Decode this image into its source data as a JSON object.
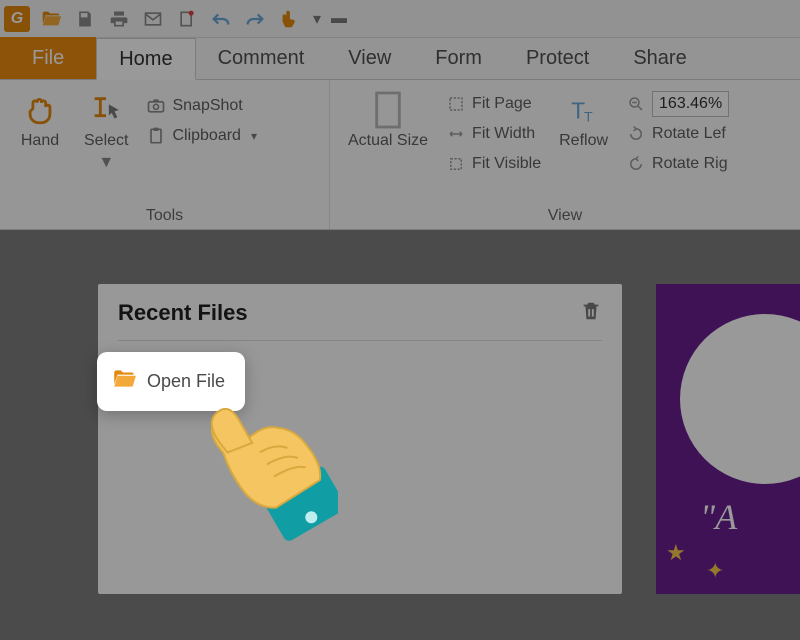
{
  "qat": {
    "logo_char": "G"
  },
  "tabs": {
    "file": "File",
    "items": [
      "Home",
      "Comment",
      "View",
      "Form",
      "Protect",
      "Share"
    ],
    "active_index": 0
  },
  "ribbon": {
    "tools_group": {
      "label": "Tools",
      "hand": "Hand",
      "select": "Select",
      "snapshot": "SnapShot",
      "clipboard": "Clipboard"
    },
    "view_group": {
      "label": "View",
      "actual_size": "Actual Size",
      "fit_page": "Fit Page",
      "fit_width": "Fit Width",
      "fit_visible": "Fit Visible",
      "reflow": "Reflow",
      "zoom_value": "163.46%",
      "rotate_left": "Rotate Lef",
      "rotate_right": "Rotate Rig"
    }
  },
  "panel": {
    "title": "Recent Files",
    "open_file": "Open File"
  },
  "sidecard": {
    "quote_start": "\"A"
  },
  "colors": {
    "accent": "#e98a0f",
    "purple": "#6a1f8e"
  }
}
